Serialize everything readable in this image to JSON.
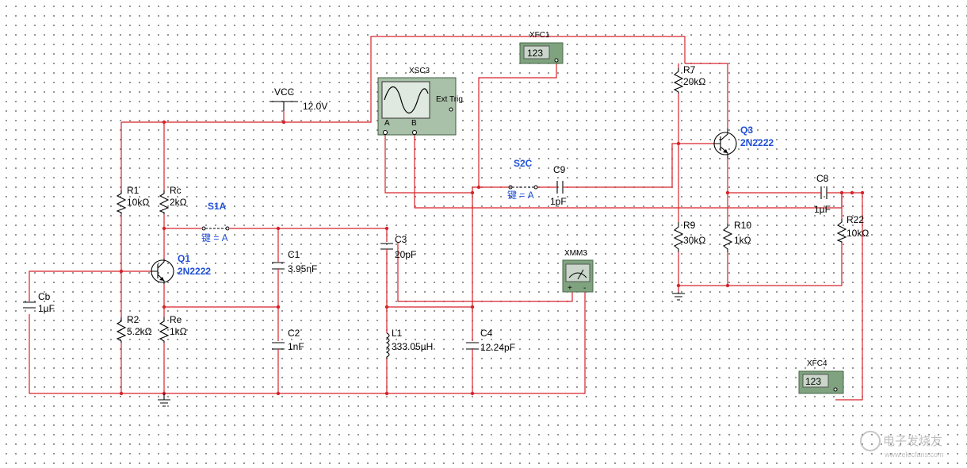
{
  "colors": {
    "wire": "#d6232a",
    "label_blue": "#1f4fd6",
    "component": "#000000",
    "instrument": "#7fa37f"
  },
  "supply": {
    "name": "VCC",
    "value": "12.0V"
  },
  "resistors": {
    "r1": {
      "ref": "R1",
      "value": "10kΩ"
    },
    "rc": {
      "ref": "Rc",
      "value": "2kΩ"
    },
    "r2": {
      "ref": "R2",
      "value": "5.2kΩ"
    },
    "re": {
      "ref": "Re",
      "value": "1kΩ"
    },
    "r7": {
      "ref": "R7",
      "value": "20kΩ"
    },
    "r9": {
      "ref": "R9",
      "value": "30kΩ"
    },
    "r10": {
      "ref": "R10",
      "value": "1kΩ"
    },
    "r22": {
      "ref": "R22",
      "value": "10kΩ"
    }
  },
  "capacitors": {
    "cb": {
      "ref": "Cb",
      "value": "1µF"
    },
    "c1": {
      "ref": "C1",
      "value": "3.95nF"
    },
    "c2": {
      "ref": "C2",
      "value": "1nF"
    },
    "c3": {
      "ref": "C3",
      "value": "20pF"
    },
    "c4": {
      "ref": "C4",
      "value": "12.24pF"
    },
    "c8": {
      "ref": "C8",
      "value": "1µF"
    },
    "c9": {
      "ref": "C9",
      "value": "1pF"
    }
  },
  "inductor": {
    "ref": "L1",
    "value": "333.05µH"
  },
  "transistors": {
    "q1": {
      "ref": "Q1",
      "model": "2N2222"
    },
    "q3": {
      "ref": "Q3",
      "model": "2N2222"
    }
  },
  "switches": {
    "s1a": {
      "ref": "S1A",
      "key": "键 = A"
    },
    "s2c": {
      "ref": "S2C",
      "key": "键 = A"
    }
  },
  "instruments": {
    "xsc3": {
      "ref": "XSC3",
      "ext_trig": "Ext Trig",
      "chan_a": "A",
      "chan_b": "B"
    },
    "xfc1": {
      "ref": "XFC1",
      "display": "123"
    },
    "xfc4": {
      "ref": "XFC4",
      "display": "123"
    },
    "xmm3": {
      "ref": "XMM3",
      "plus": "+",
      "minus": "-"
    }
  },
  "watermark": {
    "text": "电子发烧友",
    "url": "www.elecfans.com"
  }
}
